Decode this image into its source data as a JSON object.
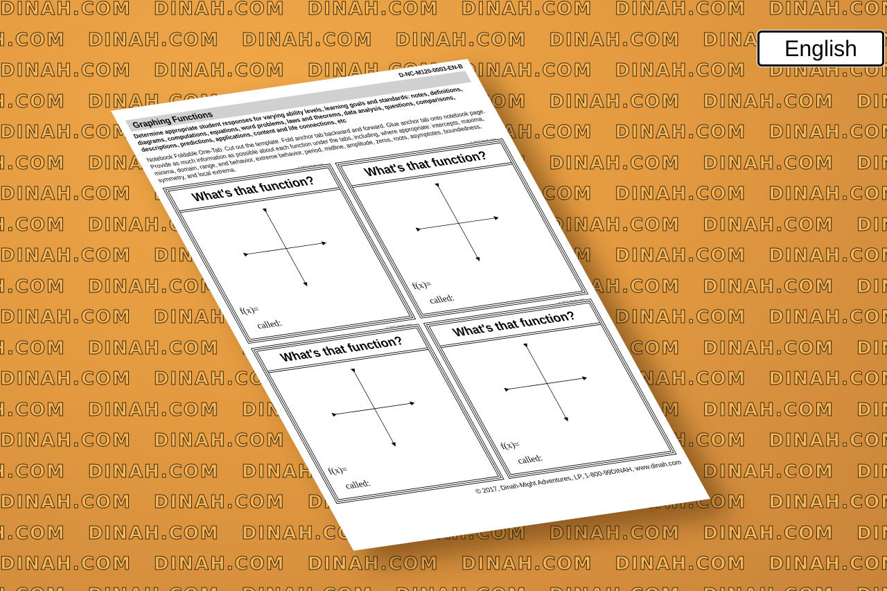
{
  "watermark": "DINAH.COM",
  "language_button": "English",
  "worksheet": {
    "code": "D-NC-M120-0003-EN-B",
    "title": "Graphing Functions",
    "standards_text": "Determine appropriate student responses for varying ability levels, learning goals and standards: notes, definitions, diagrams, computations, equations, word problems, laws and theorems, data analysis, questions, comparisons, descriptions, predictions, applications, content and life connections, etc",
    "instructions": "Notebook Foldable One-Tab: Cut out the template. Fold anchor tab backward and forward. Glue anchor tab onto notebook page. Provide as much information as possible about each function under the tabs, including, where appropriate: intercepts, maxima, minima, domain, range, end behavior, extreme behavior, period, midline, amplitude, zeros, roots, asymptotes, boundedness, symmetry, and local extrema.",
    "panels": [
      {
        "title": "What's that function?",
        "copyright": "© 2017 dinah.com",
        "fx_label": "f(x)=",
        "called_label": "called:"
      },
      {
        "title": "What's that function?",
        "copyright": "© 2017 dinah.com",
        "fx_label": "f(x)=",
        "called_label": "called:"
      },
      {
        "title": "What's that function?",
        "copyright": "© 2017 dinah.com",
        "fx_label": "f(x)=",
        "called_label": "called:"
      },
      {
        "title": "What's that function?",
        "copyright": "© 2017 dinah.com",
        "fx_label": "f(x)=",
        "called_label": "called:"
      }
    ],
    "footer": "© 2017, Dinah-Might Adventures, LP, 1-800-99DINAH, www.dinah.com"
  }
}
